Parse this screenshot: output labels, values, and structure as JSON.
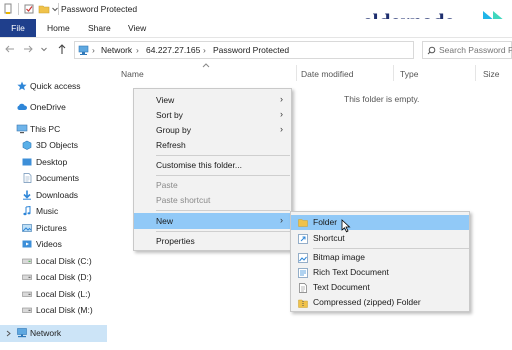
{
  "window": {
    "title": "Password Protected"
  },
  "logo": {
    "text": "eldernode"
  },
  "ribbon": {
    "tabs": [
      "File",
      "Home",
      "Share",
      "View"
    ]
  },
  "address": {
    "segments": [
      "Network",
      "64.227.27.165",
      "Password Protected"
    ],
    "separator": "›"
  },
  "search": {
    "placeholder": "Search Password Prot"
  },
  "sidebar": {
    "items": [
      {
        "label": "Quick access",
        "icon": "star-icon"
      },
      {
        "label": "OneDrive",
        "icon": "cloud-icon"
      },
      {
        "label": "This PC",
        "icon": "computer-icon"
      },
      {
        "label": "3D Objects",
        "icon": "cube-icon"
      },
      {
        "label": "Desktop",
        "icon": "desktop-icon"
      },
      {
        "label": "Documents",
        "icon": "documents-icon"
      },
      {
        "label": "Downloads",
        "icon": "download-icon"
      },
      {
        "label": "Music",
        "icon": "music-icon"
      },
      {
        "label": "Pictures",
        "icon": "pictures-icon"
      },
      {
        "label": "Videos",
        "icon": "videos-icon"
      },
      {
        "label": "Local Disk (C:)",
        "icon": "disk-icon"
      },
      {
        "label": "Local Disk (D:)",
        "icon": "disk-icon"
      },
      {
        "label": "Local Disk (L:)",
        "icon": "disk-icon"
      },
      {
        "label": "Local Disk (M:)",
        "icon": "disk-icon"
      },
      {
        "label": "Network",
        "icon": "network-icon"
      }
    ]
  },
  "columns": [
    "Name",
    "Date modified",
    "Type",
    "Size"
  ],
  "content": {
    "empty_message": "This folder is empty."
  },
  "context_menu": {
    "items": [
      {
        "label": "View",
        "submenu": true
      },
      {
        "label": "Sort by",
        "submenu": true
      },
      {
        "label": "Group by",
        "submenu": true
      },
      {
        "label": "Refresh"
      },
      {
        "label": "Customise this folder..."
      },
      {
        "label": "Paste",
        "disabled": true
      },
      {
        "label": "Paste shortcut",
        "disabled": true
      },
      {
        "label": "New",
        "submenu": true,
        "highlighted": true
      },
      {
        "label": "Properties"
      }
    ]
  },
  "new_submenu": {
    "items": [
      {
        "label": "Folder",
        "icon": "folder-icon",
        "highlighted": true
      },
      {
        "label": "Shortcut",
        "icon": "shortcut-icon"
      },
      {
        "label": "Bitmap image",
        "icon": "bitmap-icon"
      },
      {
        "label": "Rich Text Document",
        "icon": "rtf-icon"
      },
      {
        "label": "Text Document",
        "icon": "text-document-icon"
      },
      {
        "label": "Compressed (zipped) Folder",
        "icon": "zip-folder-icon"
      }
    ]
  },
  "colors": {
    "file_tab": "#1f3f8c",
    "selection": "#cce4f7",
    "menu_highlight": "#91c9f7",
    "logo": "#1e2e6e"
  }
}
